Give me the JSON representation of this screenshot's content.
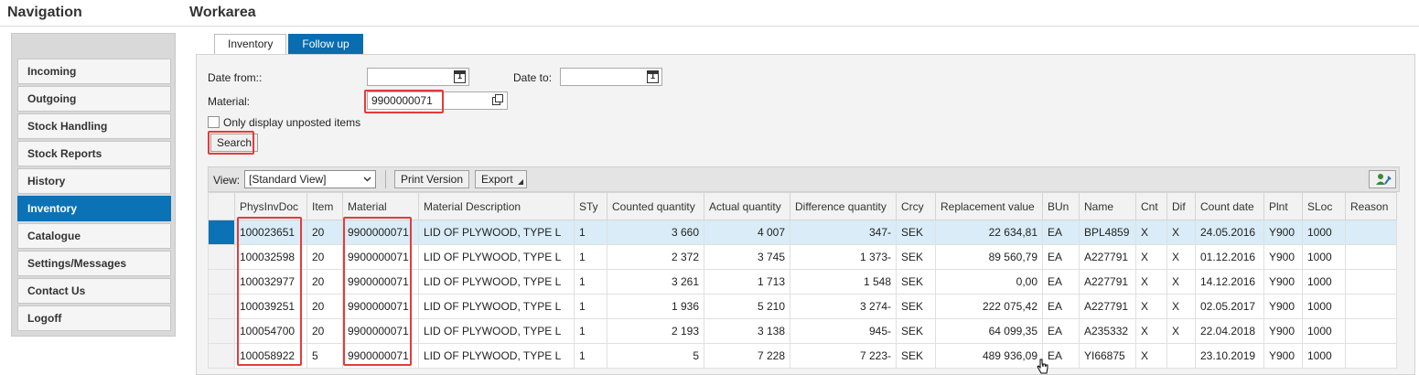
{
  "headers": {
    "navigation": "Navigation",
    "workarea": "Workarea"
  },
  "nav": {
    "items": [
      {
        "label": "Incoming"
      },
      {
        "label": "Outgoing"
      },
      {
        "label": "Stock Handling"
      },
      {
        "label": "Stock Reports"
      },
      {
        "label": "History"
      },
      {
        "label": "Inventory",
        "active": true
      },
      {
        "label": "Catalogue"
      },
      {
        "label": "Settings/Messages"
      },
      {
        "label": "Contact Us"
      },
      {
        "label": "Logoff"
      }
    ]
  },
  "tabs": [
    {
      "label": "Inventory",
      "active": false
    },
    {
      "label": "Follow up",
      "active": true
    }
  ],
  "form": {
    "date_from_label": "Date from::",
    "date_from_value": "",
    "date_to_label": "Date to:",
    "date_to_value": "",
    "material_label": "Material:",
    "material_value": "9900000071",
    "unposted_label": "Only display unposted items",
    "unposted_checked": false,
    "search_label": "Search"
  },
  "toolbar": {
    "view_label": "View:",
    "view_value": "[Standard View]",
    "print_label": "Print Version",
    "export_label": "Export"
  },
  "table": {
    "columns": [
      "PhysInvDoc",
      "Item",
      "Material",
      "Material Description",
      "STy",
      "Counted quantity",
      "Actual quantity",
      "Difference quantity",
      "Crcy",
      "Replacement value",
      "BUn",
      "Name",
      "Cnt",
      "Dif",
      "Count date",
      "Plnt",
      "SLoc",
      "Reason"
    ],
    "rows": [
      [
        "100023651",
        "20",
        "9900000071",
        "LID OF PLYWOOD, TYPE L",
        "1",
        "3 660",
        "4 007",
        "347-",
        "SEK",
        "22 634,81",
        "EA",
        "BPL4859",
        "X",
        "X",
        "24.05.2016",
        "Y900",
        "1000",
        ""
      ],
      [
        "100032598",
        "20",
        "9900000071",
        "LID OF PLYWOOD, TYPE L",
        "1",
        "2 372",
        "3 745",
        "1 373-",
        "SEK",
        "89 560,79",
        "EA",
        "A227791",
        "X",
        "X",
        "01.12.2016",
        "Y900",
        "1000",
        ""
      ],
      [
        "100032977",
        "20",
        "9900000071",
        "LID OF PLYWOOD, TYPE L",
        "1",
        "3 261",
        "1 713",
        "1 548",
        "SEK",
        "0,00",
        "EA",
        "A227791",
        "X",
        "X",
        "14.12.2016",
        "Y900",
        "1000",
        ""
      ],
      [
        "100039251",
        "20",
        "9900000071",
        "LID OF PLYWOOD, TYPE L",
        "1",
        "1 936",
        "5 210",
        "3 274-",
        "SEK",
        "222 075,42",
        "EA",
        "A227791",
        "X",
        "X",
        "02.05.2017",
        "Y900",
        "1000",
        ""
      ],
      [
        "100054700",
        "20",
        "9900000071",
        "LID OF PLYWOOD, TYPE L",
        "1",
        "2 193",
        "3 138",
        "945-",
        "SEK",
        "64 099,35",
        "EA",
        "A235332",
        "X",
        "X",
        "22.04.2018",
        "Y900",
        "1000",
        ""
      ],
      [
        "100058922",
        "5",
        "9900000071",
        "LID OF PLYWOOD, TYPE L",
        "1",
        "5",
        "7 228",
        "7 223-",
        "SEK",
        "489 936,09",
        "EA",
        "YI66875",
        "X",
        "",
        "23.10.2019",
        "Y900",
        "1000",
        ""
      ]
    ]
  },
  "colors": {
    "accent": "#0b72b5",
    "highlight": "#e43b3b",
    "selected_row": "#d9ecf7"
  }
}
